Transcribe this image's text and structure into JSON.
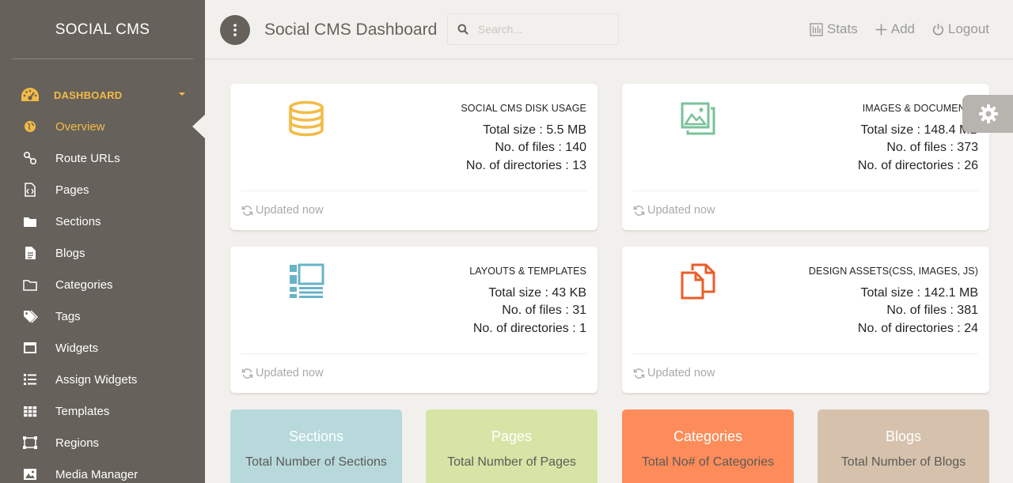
{
  "brand": "SOCIAL CMS",
  "sidebar": {
    "section_label": "DASHBOARD",
    "items": [
      {
        "label": "Overview",
        "icon": "globe-icon",
        "active": true
      },
      {
        "label": "Route URLs",
        "icon": "route-icon"
      },
      {
        "label": "Pages",
        "icon": "code-file-icon"
      },
      {
        "label": "Sections",
        "icon": "folder-icon"
      },
      {
        "label": "Blogs",
        "icon": "document-icon"
      },
      {
        "label": "Categories",
        "icon": "folder-outline-icon"
      },
      {
        "label": "Tags",
        "icon": "tags-icon"
      },
      {
        "label": "Widgets",
        "icon": "window-icon"
      },
      {
        "label": "Assign Widgets",
        "icon": "list-icon"
      },
      {
        "label": "Templates",
        "icon": "grid-icon"
      },
      {
        "label": "Regions",
        "icon": "regions-icon"
      },
      {
        "label": "Media Manager",
        "icon": "image-icon"
      }
    ]
  },
  "header": {
    "title": "Social CMS Dashboard",
    "search_placeholder": "Search...",
    "actions": [
      {
        "label": "Stats",
        "icon": "stats-icon"
      },
      {
        "label": "Add",
        "icon": "plus-icon"
      },
      {
        "label": "Logout",
        "icon": "power-icon"
      }
    ]
  },
  "cards": [
    {
      "title": "SOCIAL CMS DISK USAGE",
      "total_size": "Total size : 5.5 MB",
      "files": "No. of files : 140",
      "directories": "No. of directories : 13",
      "footer": "Updated now",
      "icon": "database-icon",
      "color": "#f3bb45"
    },
    {
      "title": "IMAGES & DOCUMENTS",
      "total_size": "Total size : 148.4 MB",
      "files": "No. of files : 373",
      "directories": "No. of directories : 26",
      "footer": "Updated now",
      "icon": "gallery-icon",
      "color": "#7ac29a"
    },
    {
      "title": "LAYOUTS & TEMPLATES",
      "total_size": "Total size : 43 KB",
      "files": "No. of files : 31",
      "directories": "No. of directories : 1",
      "footer": "Updated now",
      "icon": "layout-icon",
      "color": "#68b3c8"
    },
    {
      "title": "DESIGN ASSETS(CSS, IMAGES, JS)",
      "total_size": "Total size : 142.1 MB",
      "files": "No. of files : 381",
      "directories": "No. of directories : 24",
      "footer": "Updated now",
      "icon": "files-icon",
      "color": "#eb5e28"
    }
  ],
  "tiles": [
    {
      "title": "Sections",
      "subtitle": "Total Number of Sections",
      "color": "#b8d9dc"
    },
    {
      "title": "Pages",
      "subtitle": "Total Number of Pages",
      "color": "#d6e5a5"
    },
    {
      "title": "Categories",
      "subtitle": "Total No# of Categories",
      "color": "#fd8c5a"
    },
    {
      "title": "Blogs",
      "subtitle": "Total Number of Blogs",
      "color": "#d6c2ac"
    }
  ],
  "colors": {
    "sidebar": "#66615b",
    "accent": "#f3bb45",
    "background": "#f2f0ed"
  }
}
